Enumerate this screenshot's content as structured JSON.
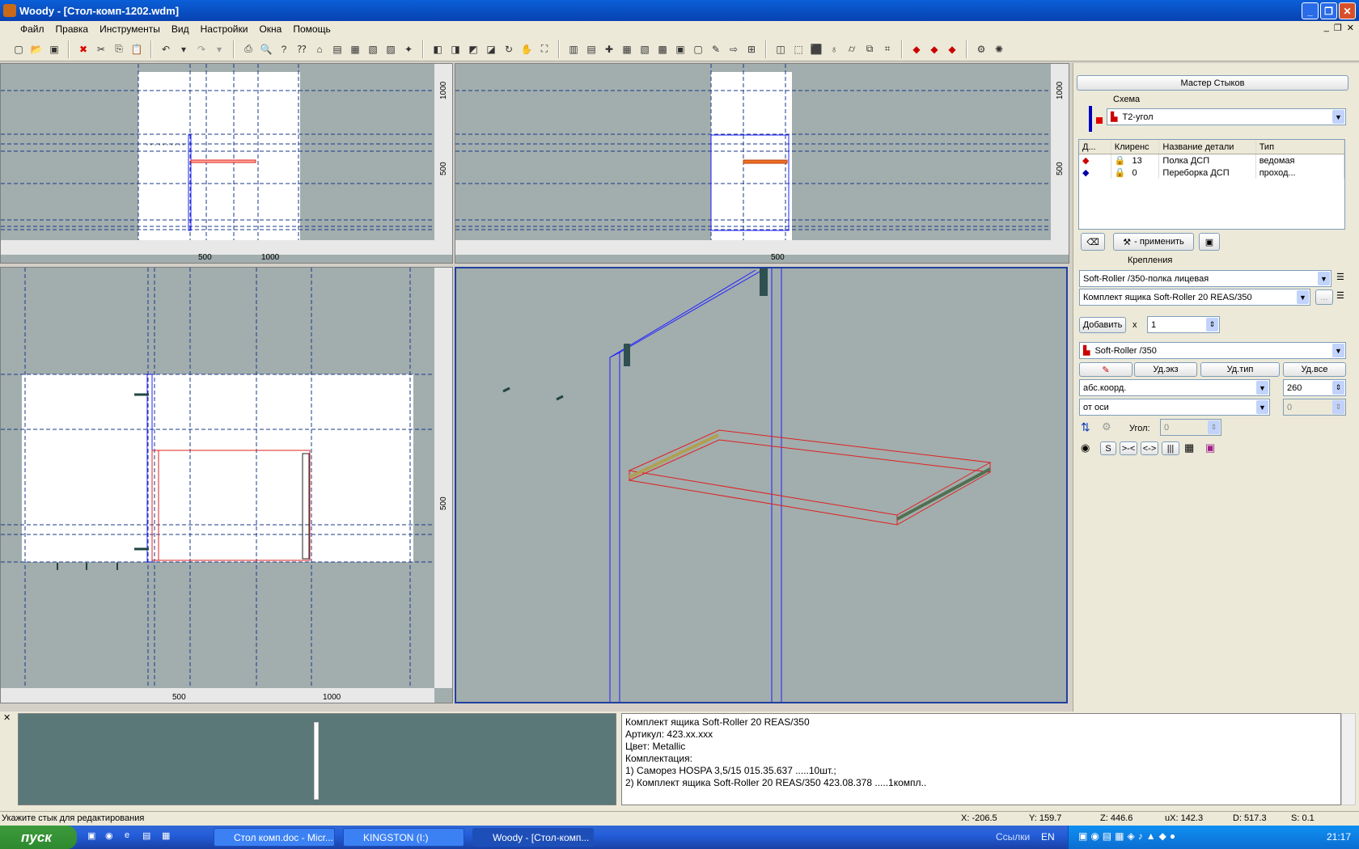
{
  "window": {
    "title": "Woody - [Стол-комп-1202.wdm]"
  },
  "menu": [
    "Файл",
    "Правка",
    "Инструменты",
    "Вид",
    "Настройки",
    "Окна",
    "Помощь"
  ],
  "views": {
    "top_left": {
      "ruler_labels": [
        "1000",
        "500",
        "500",
        "1000"
      ]
    },
    "top_right": {
      "ruler_labels": [
        "1000",
        "500",
        "500"
      ]
    },
    "bottom_left": {
      "ruler_labels": [
        "500",
        "500",
        "1000"
      ]
    }
  },
  "panel": {
    "wizard_button": "Мастер Стыков",
    "scheme_label": "Схема",
    "scheme_value": "Т2-угол",
    "grid": {
      "headers": [
        "Д...",
        "Клиренс",
        "Название детали",
        "Тип"
      ],
      "rows": [
        {
          "clearance": "13",
          "name": "Полка ДСП",
          "type": "ведомая",
          "color": "#cc0000"
        },
        {
          "clearance": "0",
          "name": "Переборка ДСП",
          "type": "проход...",
          "color": "#0000aa"
        }
      ]
    },
    "apply_button": "- применить",
    "fasteners_label": "Крепления",
    "fastener_combo1": "Soft-Roller /350-полка лицевая",
    "fastener_combo2": "Комплект ящика Soft-Roller 20 REAS/350",
    "add_button": "Добавить",
    "x_label": "x",
    "qty": "1",
    "instance_combo": "Soft-Roller /350",
    "del_inst": "Уд.экз",
    "del_type": "Уд.тип",
    "del_all": "Уд.все",
    "coord_combo": "абс.коорд.",
    "coord_value": "260",
    "axis_combo": "от оси",
    "axis_value": "0",
    "angle_label": "Угол:",
    "angle_value": "0",
    "small_buttons": [
      "S",
      ">-<",
      "<->",
      "|||"
    ]
  },
  "info": {
    "lines": [
      "Комплект ящика Soft-Roller 20 REAS/350",
      "Артикул: 423.xx.xxx",
      "Цвет: Metallic",
      "Комплектация:",
      "1) Саморез HOSPA 3,5/15 015.35.637 .....10шт.;",
      "2) Комплект ящика Soft-Roller 20 REAS/350 423.08.378 .....1компл.."
    ]
  },
  "status": {
    "hint": "Укажите стык для редактирования",
    "x": "X:  -206.5",
    "y": "Y:  159.7",
    "z": "Z:  446.6",
    "ux": "uX:  142.3",
    "d": "D:  517.3",
    "s": "S:  0.1"
  },
  "taskbar": {
    "start": "пуск",
    "tasks": [
      "Стол комп.doc - Micr...",
      "KINGSTON (I:)",
      "Woody - [Стол-комп..."
    ],
    "links": "Ссылки",
    "lang": "EN",
    "clock": "21:17"
  },
  "colors": {
    "viewport": "#a2adad",
    "selection": "#ff2020",
    "wire": "#2020ff"
  }
}
